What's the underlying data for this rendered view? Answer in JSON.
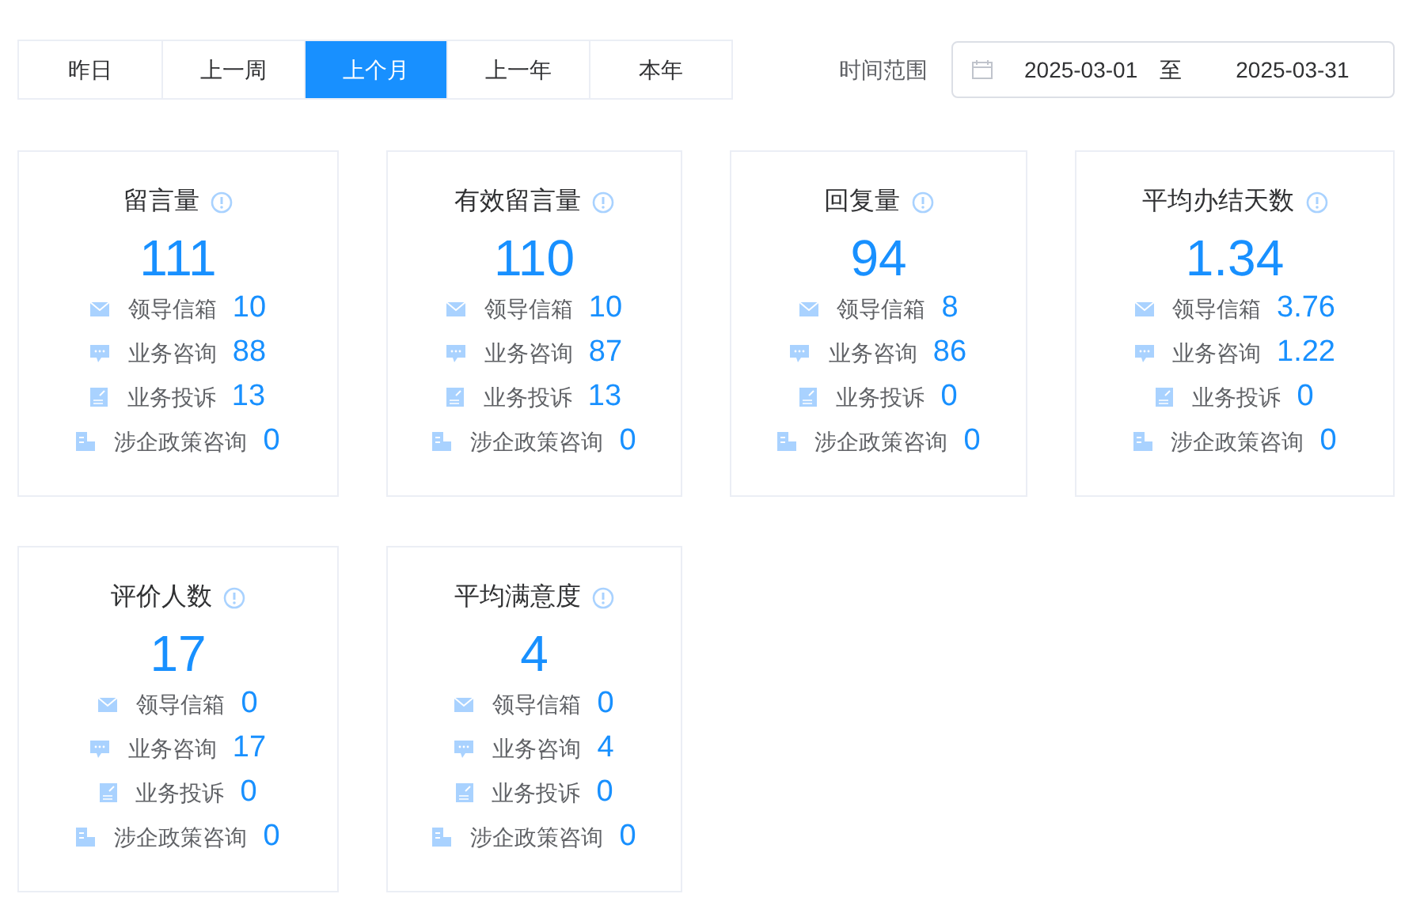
{
  "tabs": [
    {
      "label": "昨日",
      "selected": false
    },
    {
      "label": "上一周",
      "selected": false
    },
    {
      "label": "上个月",
      "selected": true
    },
    {
      "label": "上一年",
      "selected": false
    },
    {
      "label": "本年",
      "selected": false
    }
  ],
  "time_range": {
    "label": "时间范围",
    "start": "2025-03-01",
    "separator": "至",
    "end": "2025-03-31"
  },
  "cards": [
    {
      "title": "留言量",
      "value": "111",
      "rows": [
        {
          "kind": "mail",
          "label": "领导信箱",
          "value": "10"
        },
        {
          "kind": "chat",
          "label": "业务咨询",
          "value": "88"
        },
        {
          "kind": "doc",
          "label": "业务投诉",
          "value": "13"
        },
        {
          "kind": "org",
          "label": "涉企政策咨询",
          "value": "0"
        }
      ]
    },
    {
      "title": "有效留言量",
      "value": "110",
      "rows": [
        {
          "kind": "mail",
          "label": "领导信箱",
          "value": "10"
        },
        {
          "kind": "chat",
          "label": "业务咨询",
          "value": "87"
        },
        {
          "kind": "doc",
          "label": "业务投诉",
          "value": "13"
        },
        {
          "kind": "org",
          "label": "涉企政策咨询",
          "value": "0"
        }
      ]
    },
    {
      "title": "回复量",
      "value": "94",
      "rows": [
        {
          "kind": "mail",
          "label": "领导信箱",
          "value": "8"
        },
        {
          "kind": "chat",
          "label": "业务咨询",
          "value": "86"
        },
        {
          "kind": "doc",
          "label": "业务投诉",
          "value": "0"
        },
        {
          "kind": "org",
          "label": "涉企政策咨询",
          "value": "0"
        }
      ]
    },
    {
      "title": "平均办结天数",
      "value": "1.34",
      "rows": [
        {
          "kind": "mail",
          "label": "领导信箱",
          "value": "3.76"
        },
        {
          "kind": "chat",
          "label": "业务咨询",
          "value": "1.22"
        },
        {
          "kind": "doc",
          "label": "业务投诉",
          "value": "0"
        },
        {
          "kind": "org",
          "label": "涉企政策咨询",
          "value": "0"
        }
      ]
    },
    {
      "title": "评价人数",
      "value": "17",
      "rows": [
        {
          "kind": "mail",
          "label": "领导信箱",
          "value": "0"
        },
        {
          "kind": "chat",
          "label": "业务咨询",
          "value": "17"
        },
        {
          "kind": "doc",
          "label": "业务投诉",
          "value": "0"
        },
        {
          "kind": "org",
          "label": "涉企政策咨询",
          "value": "0"
        }
      ]
    },
    {
      "title": "平均满意度",
      "value": "4",
      "rows": [
        {
          "kind": "mail",
          "label": "领导信箱",
          "value": "0"
        },
        {
          "kind": "chat",
          "label": "业务咨询",
          "value": "4"
        },
        {
          "kind": "doc",
          "label": "业务投诉",
          "value": "0"
        },
        {
          "kind": "org",
          "label": "涉企政策咨询",
          "value": "0"
        }
      ]
    }
  ]
}
